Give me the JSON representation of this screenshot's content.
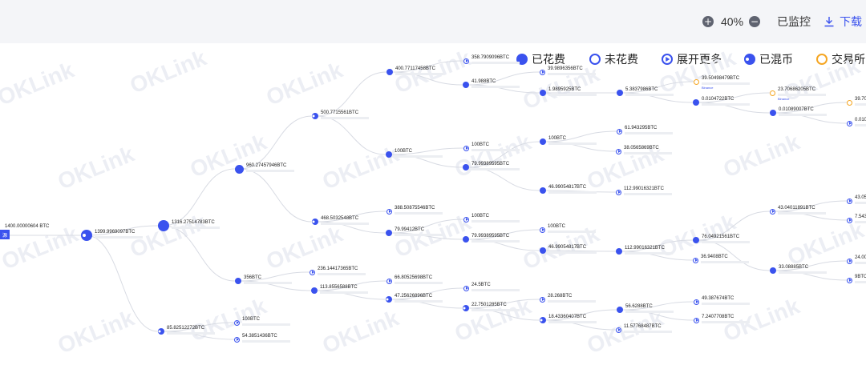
{
  "toolbar": {
    "zoom": "40%",
    "monitored": "已监控",
    "download": "下载",
    "plus_icon": "plus-icon",
    "minus_icon": "minus-icon",
    "download_icon": "download-icon"
  },
  "legend": [
    {
      "label": "已花费",
      "kind": "spent"
    },
    {
      "label": "未花费",
      "kind": "unspent"
    },
    {
      "label": "展开更多",
      "kind": "expand"
    },
    {
      "label": "已混币",
      "kind": "mixed"
    },
    {
      "label": "交易所",
      "kind": "exchange"
    }
  ],
  "watermark": "OKLink",
  "colors": {
    "primary": "#3a52ee",
    "exchange": "#f5a623",
    "edge": "#d8dbe3"
  },
  "root": {
    "label": "1400.00000604 BTC",
    "badge": "源"
  },
  "nodes": [
    {
      "id": "n1",
      "amount": "1399.9969097BTC",
      "kind": "mixed"
    },
    {
      "id": "n2",
      "amount": "1316.27514783BTC",
      "kind": "spent"
    },
    {
      "id": "n3",
      "amount": "85.82512272BTC",
      "kind": "mixed"
    },
    {
      "id": "n4",
      "amount": "960.27457946BTC",
      "kind": "spent"
    },
    {
      "id": "n5",
      "amount": "356BTC",
      "kind": "spent"
    },
    {
      "id": "n6",
      "amount": "100BTC",
      "kind": "expand"
    },
    {
      "id": "n7",
      "amount": "54.3851436BTC",
      "kind": "expand"
    },
    {
      "id": "n8",
      "amount": "500.7715561BTC",
      "kind": "mixed"
    },
    {
      "id": "n9",
      "amount": "468.5032548BTC",
      "kind": "mixed"
    },
    {
      "id": "n10",
      "amount": "236.14417365BTC",
      "kind": "expand"
    },
    {
      "id": "n11",
      "amount": "113.8556588BTC",
      "kind": "spent"
    },
    {
      "id": "n12",
      "amount": "400.77117458BTC",
      "kind": "spent"
    },
    {
      "id": "n13",
      "amount": "100BTC",
      "kind": "spent"
    },
    {
      "id": "n14",
      "amount": "388.50875546BTC",
      "kind": "expand"
    },
    {
      "id": "n15",
      "amount": "79.99412BTC",
      "kind": "spent"
    },
    {
      "id": "n16",
      "amount": "66.80525698BTC",
      "kind": "expand"
    },
    {
      "id": "n17",
      "amount": "47.25626896BTC",
      "kind": "mixed"
    },
    {
      "id": "n18",
      "amount": "358.7909096BTC",
      "kind": "expand"
    },
    {
      "id": "n19",
      "amount": "41.988BTC",
      "kind": "spent"
    },
    {
      "id": "n20",
      "amount": "100BTC",
      "kind": "expand"
    },
    {
      "id": "n21",
      "amount": "79.99389595BTC",
      "kind": "spent"
    },
    {
      "id": "n22",
      "amount": "100BTC",
      "kind": "expand"
    },
    {
      "id": "n23",
      "amount": "79.99389595BTC",
      "kind": "spent"
    },
    {
      "id": "n24",
      "amount": "24.5BTC",
      "kind": "expand"
    },
    {
      "id": "n25",
      "amount": "22.7501285BTC",
      "kind": "mixed"
    },
    {
      "id": "n26",
      "amount": "39.9896356BTC",
      "kind": "expand"
    },
    {
      "id": "n27",
      "amount": "1.9895925BTC",
      "kind": "spent"
    },
    {
      "id": "n28",
      "amount": "100BTC",
      "kind": "spent"
    },
    {
      "id": "n29",
      "amount": "46.99054817BTC",
      "kind": "spent"
    },
    {
      "id": "n30",
      "amount": "100BTC",
      "kind": "expand"
    },
    {
      "id": "n31",
      "amount": "46.99054817BTC",
      "kind": "spent"
    },
    {
      "id": "n32",
      "amount": "28.268BTC",
      "kind": "expand"
    },
    {
      "id": "n33",
      "amount": "18.43360407BTC",
      "kind": "mixed"
    },
    {
      "id": "n34",
      "amount": "5.3837986BTC",
      "kind": "spent"
    },
    {
      "id": "n35",
      "amount": "61.943295BTC",
      "kind": "expand"
    },
    {
      "id": "n36",
      "amount": "38.0565869BTC",
      "kind": "expand"
    },
    {
      "id": "n37",
      "amount": "112.99016321BTC",
      "kind": "expand"
    },
    {
      "id": "n38",
      "amount": "112.99016321BTC",
      "kind": "spent"
    },
    {
      "id": "n39",
      "amount": "56.6288BTC",
      "kind": "spent"
    },
    {
      "id": "n40",
      "amount": "11.57768487BTC",
      "kind": "expand"
    },
    {
      "id": "n41",
      "amount": "39.50498479BTC",
      "kind": "exchange",
      "exchange": "Binance"
    },
    {
      "id": "n42",
      "amount": "0.0104722BTC",
      "kind": "spent"
    },
    {
      "id": "n43",
      "amount": "76.04921561BTC",
      "kind": "spent"
    },
    {
      "id": "n44",
      "amount": "36.9408BTC",
      "kind": "expand"
    },
    {
      "id": "n45",
      "amount": "49.387674BTC",
      "kind": "expand"
    },
    {
      "id": "n46",
      "amount": "7.2407708BTC",
      "kind": "expand"
    },
    {
      "id": "n47",
      "amount": "23.70686205BTC",
      "kind": "exchange",
      "exchange": "Binance"
    },
    {
      "id": "n48",
      "amount": "0.01089007BTC",
      "kind": "spent"
    },
    {
      "id": "n49",
      "amount": "43.04011891BTC",
      "kind": "expand"
    },
    {
      "id": "n50",
      "amount": "33.08885BTC",
      "kind": "spent"
    },
    {
      "id": "n51",
      "amount": "39.70",
      "kind": "exchange"
    },
    {
      "id": "n52",
      "amount": "0.010",
      "kind": "expand"
    },
    {
      "id": "n53",
      "amount": "43.05",
      "kind": "expand"
    },
    {
      "id": "n54",
      "amount": "7.543",
      "kind": "expand"
    },
    {
      "id": "n55",
      "amount": "24.00",
      "kind": "expand"
    },
    {
      "id": "n56",
      "amount": "9BTC",
      "kind": "expand"
    }
  ]
}
